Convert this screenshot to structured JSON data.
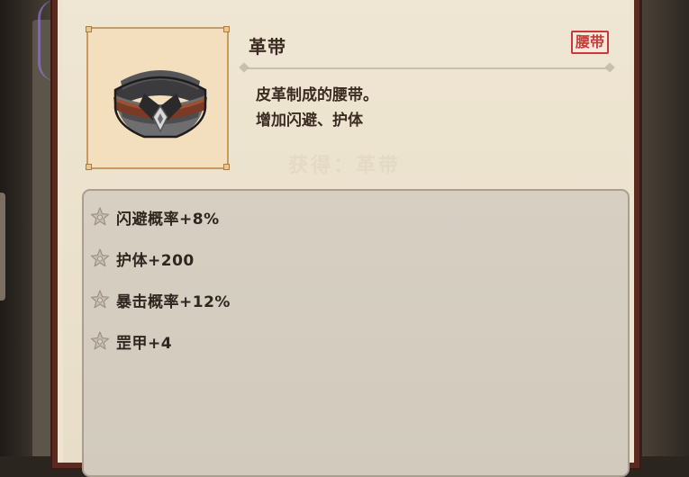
{
  "item": {
    "name": "革带",
    "type_stamp": "腰带",
    "description_lines": [
      "皮革制成的腰带。",
      "增加闪避、护体"
    ],
    "watermark": "获得：革带"
  },
  "icon": {
    "semantic": "leather-belt-icon"
  },
  "stats": [
    {
      "label": "闪避概率+8%"
    },
    {
      "label": "护体+200"
    },
    {
      "label": "暴击概率+12%"
    },
    {
      "label": "罡甲+4"
    }
  ],
  "colors": {
    "card_border": "#5a2a1f",
    "stamp_red": "#c8393a",
    "text_dark": "#3b2b22",
    "frame_gold": "#c79a62"
  }
}
